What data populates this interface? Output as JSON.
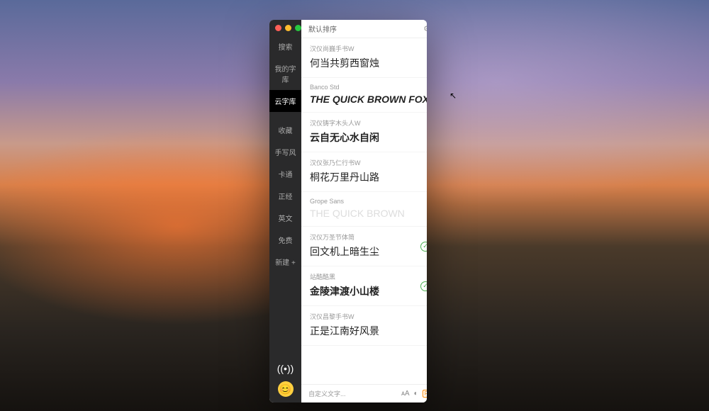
{
  "sidebar": {
    "search": "搜索",
    "my_fonts": "我的字库",
    "cloud_fonts": "云字库",
    "favorites": "收藏",
    "handwriting": "手写风",
    "cartoon": "卡通",
    "serious": "正经",
    "english": "英文",
    "free": "免费",
    "new": "新建 +"
  },
  "header": {
    "sort": "默认排序"
  },
  "fonts": [
    {
      "name": "汉仪尚巍手书W",
      "preview": "何当共剪西窗烛",
      "style": "script"
    },
    {
      "name": "Banco Std",
      "preview": "THE QUICK BROWN FOX",
      "style": "italic"
    },
    {
      "name": "汉仪铸字木头人W",
      "preview": "云自无心水自闲",
      "style": "bold"
    },
    {
      "name": "汉仪张乃仁行书W",
      "preview": "桐花万里丹山路",
      "style": "script"
    },
    {
      "name": "Grope Sans",
      "preview": "THE QUICK BROWN",
      "style": "faded"
    },
    {
      "name": "汉仪万圣节体简",
      "preview": "回文机上暗生尘",
      "style": "",
      "checked": true
    },
    {
      "name": "站酷酷黑",
      "preview": "金陵津渡小山楼",
      "style": "bold",
      "checked": true
    },
    {
      "name": "汉仪昌黎手书W",
      "preview": "正是江南好风景",
      "style": "script"
    }
  ],
  "footer": {
    "custom_text": "自定义文字...",
    "p_label": "P"
  }
}
